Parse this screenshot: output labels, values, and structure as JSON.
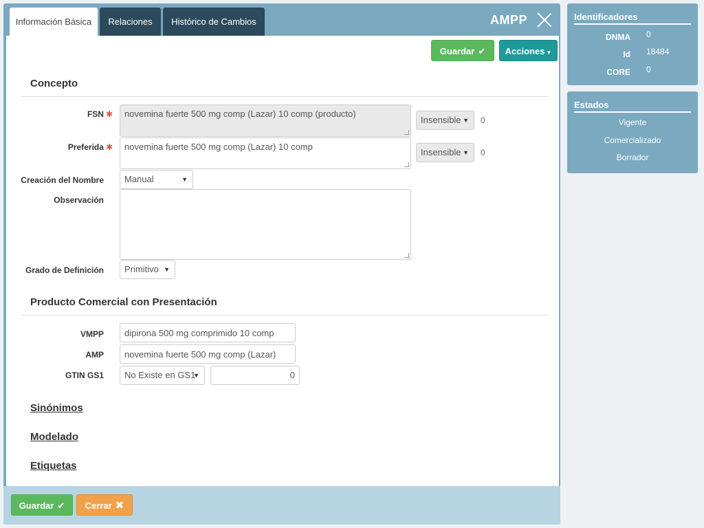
{
  "tabs": [
    {
      "label": "Información Básica",
      "active": true
    },
    {
      "label": "Relaciones",
      "active": false
    },
    {
      "label": "Histórico de Cambios",
      "active": false
    }
  ],
  "header": {
    "title": "AMPP"
  },
  "toolbar": {
    "save_label": "Guardar",
    "actions_label": "Acciones"
  },
  "concepto": {
    "title": "Concepto",
    "fsn": {
      "label": "FSN",
      "value": "novemina fuerte 500 mg comp (Lazar) 10 comp (producto)",
      "case": "Insensible",
      "count": "0"
    },
    "preferida": {
      "label": "Preferida",
      "value": "novemina fuerte 500 mg comp (Lazar) 10 comp",
      "case": "Insensible",
      "count": "0"
    },
    "creacion": {
      "label": "Creación del Nombre",
      "value": "Manual"
    },
    "observacion": {
      "label": "Observación",
      "value": ""
    },
    "grado": {
      "label": "Grado de Definición",
      "value": "Primitivo"
    }
  },
  "producto": {
    "title": "Producto Comercial con Presentación",
    "vmpp": {
      "label": "VMPP",
      "value": "dipirona 500 mg comprimido 10 comp"
    },
    "amp": {
      "label": "AMP",
      "value": "novemina fuerte 500 mg comp (Lazar)"
    },
    "gtin": {
      "label": "GTIN GS1",
      "select": "No Existe en GS1",
      "value": "0"
    }
  },
  "sections": {
    "sinonimos": "Sinónimos",
    "modelado": "Modelado",
    "etiquetas": "Etiquetas"
  },
  "footer": {
    "save_label": "Guardar",
    "close_label": "Cerrar"
  },
  "identificadores": {
    "title": "Identificadores",
    "items": [
      {
        "key": "DNMA",
        "value": "0"
      },
      {
        "key": "Id",
        "value": "18484"
      },
      {
        "key": "CORE",
        "value": "0"
      }
    ]
  },
  "estados": {
    "title": "Estados",
    "items": [
      "Vigente",
      "Comercializado",
      "Borrador"
    ]
  },
  "colors": {
    "panel": "#7aa9c0",
    "tab_dark": "#2d4a5c",
    "green": "#5cb85c",
    "teal": "#1e9a99",
    "orange": "#f0a14a"
  },
  "icons": {
    "save": "check-icon",
    "close": "close-icon",
    "cancel": "x-bold-icon"
  }
}
